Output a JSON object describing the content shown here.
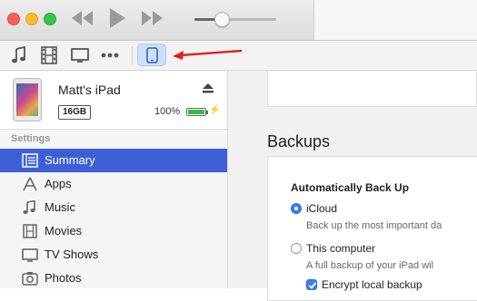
{
  "window": {
    "controls": [
      "close",
      "minimize",
      "zoom"
    ],
    "transport": [
      "rewind-icon",
      "play-icon",
      "fast-forward-icon"
    ],
    "volume": {
      "level": 0.33
    }
  },
  "media_bar": {
    "items": [
      {
        "name": "music-note-icon"
      },
      {
        "name": "film-icon"
      },
      {
        "name": "tv-icon"
      },
      {
        "name": "more-icon"
      }
    ],
    "selected_device_icon": "ipad-device-icon",
    "annotation_arrow_color": "#e0231f"
  },
  "device": {
    "name": "Matt's iPad",
    "capacity": "16GB",
    "battery_percent": "100%",
    "battery_level": 1.0,
    "charging_symbol": "⚡"
  },
  "sidebar": {
    "section_label": "Settings",
    "items": [
      {
        "label": "Summary",
        "icon": "summary-icon",
        "selected": true
      },
      {
        "label": "Apps",
        "icon": "apps-icon",
        "selected": false
      },
      {
        "label": "Music",
        "icon": "music-icon",
        "selected": false
      },
      {
        "label": "Movies",
        "icon": "movies-icon",
        "selected": false
      },
      {
        "label": "TV Shows",
        "icon": "tv-shows-icon",
        "selected": false
      },
      {
        "label": "Photos",
        "icon": "photos-icon",
        "selected": false
      }
    ]
  },
  "main": {
    "heading": "Backups",
    "auto_backup": {
      "title": "Automatically Back Up",
      "options": [
        {
          "label": "iCloud",
          "selected": true,
          "description": "Back up the most important da"
        },
        {
          "label": "This computer",
          "selected": false,
          "description": "A full backup of your iPad wil"
        }
      ],
      "encrypt_label": "Encrypt local backup",
      "encrypt_checked": true
    }
  },
  "colors": {
    "selection": "#3d5fd6",
    "accent": "#3a80ee",
    "battery": "#2fbe3f"
  }
}
